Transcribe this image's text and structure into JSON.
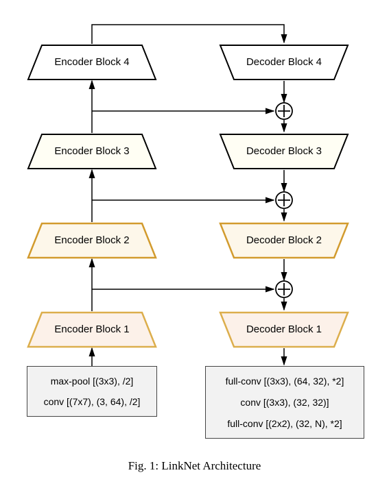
{
  "blocks": {
    "enc4": "Encoder Block 4",
    "dec4": "Decoder Block 4",
    "enc3": "Encoder Block 3",
    "dec3": "Decoder Block 3",
    "enc2": "Encoder Block 2",
    "dec2": "Decoder Block 2",
    "enc1": "Encoder Block 1",
    "dec1": "Decoder Block 1"
  },
  "input_box": {
    "line1": "max-pool [(3x3), /2]",
    "line2": "conv [(7x7), (3, 64), /2]"
  },
  "output_box": {
    "line1": "full-conv [(3x3), (64, 32), *2]",
    "line2": "conv [(3x3), (32, 32)]",
    "line3": "full-conv [(2x2), (32, N), *2]"
  },
  "caption": "Fig. 1: LinkNet Architecture",
  "colors": {
    "level4_fill": "#ffffff",
    "level4_stroke": "#000000",
    "level3_fill": "#fffef4",
    "level3_stroke": "#000000",
    "level2_fill": "#fdf7ea",
    "level2_stroke": "#d29b2e",
    "level1_fill": "#fcf1e9",
    "level1_stroke": "#dcae4c"
  },
  "chart_data": {
    "type": "diagram",
    "title": "LinkNet Architecture",
    "nodes": [
      {
        "id": "input",
        "label": [
          "max-pool [(3x3), /2]",
          "conv [(7x7), (3, 64), /2]"
        ],
        "kind": "ops"
      },
      {
        "id": "enc1",
        "label": "Encoder Block 1",
        "kind": "encoder",
        "level": 1
      },
      {
        "id": "enc2",
        "label": "Encoder Block 2",
        "kind": "encoder",
        "level": 2
      },
      {
        "id": "enc3",
        "label": "Encoder Block 3",
        "kind": "encoder",
        "level": 3
      },
      {
        "id": "enc4",
        "label": "Encoder Block 4",
        "kind": "encoder",
        "level": 4
      },
      {
        "id": "dec4",
        "label": "Decoder Block 4",
        "kind": "decoder",
        "level": 4
      },
      {
        "id": "dec3",
        "label": "Decoder Block 3",
        "kind": "decoder",
        "level": 3
      },
      {
        "id": "dec2",
        "label": "Decoder Block 2",
        "kind": "decoder",
        "level": 2
      },
      {
        "id": "dec1",
        "label": "Decoder Block 1",
        "kind": "decoder",
        "level": 1
      },
      {
        "id": "output",
        "label": [
          "full-conv [(3x3), (64, 32), *2]",
          "conv [(3x3), (32, 32)]",
          "full-conv [(2x2), (32, N), *2]"
        ],
        "kind": "ops"
      },
      {
        "id": "add3",
        "kind": "sum"
      },
      {
        "id": "add2",
        "kind": "sum"
      },
      {
        "id": "add1",
        "kind": "sum"
      }
    ],
    "edges": [
      {
        "from": "input",
        "to": "enc1"
      },
      {
        "from": "enc1",
        "to": "enc2"
      },
      {
        "from": "enc2",
        "to": "enc3"
      },
      {
        "from": "enc3",
        "to": "enc4"
      },
      {
        "from": "enc4",
        "to": "dec4"
      },
      {
        "from": "dec4",
        "to": "add3"
      },
      {
        "from": "enc3",
        "to": "add3",
        "kind": "skip"
      },
      {
        "from": "add3",
        "to": "dec3"
      },
      {
        "from": "dec3",
        "to": "add2"
      },
      {
        "from": "enc2",
        "to": "add2",
        "kind": "skip"
      },
      {
        "from": "add2",
        "to": "dec2"
      },
      {
        "from": "dec2",
        "to": "add1"
      },
      {
        "from": "enc1",
        "to": "add1",
        "kind": "skip"
      },
      {
        "from": "add1",
        "to": "dec1"
      },
      {
        "from": "dec1",
        "to": "output"
      }
    ]
  }
}
